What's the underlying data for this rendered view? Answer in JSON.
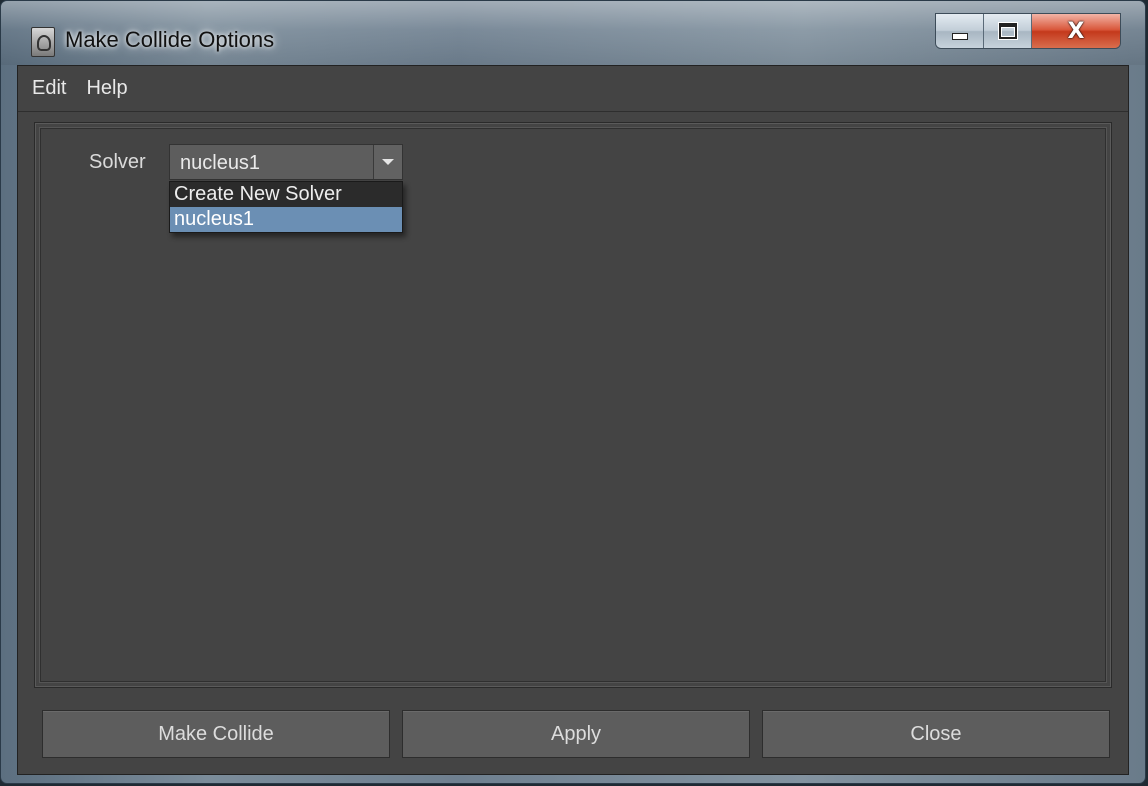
{
  "window": {
    "title": "Make Collide Options",
    "icon": "maya-app-icon"
  },
  "caption_buttons": {
    "minimize_icon": "minimize-icon",
    "maximize_icon": "maximize-icon",
    "close_label": "X"
  },
  "menubar": {
    "items": [
      {
        "label": "Edit"
      },
      {
        "label": "Help"
      }
    ]
  },
  "options": {
    "solver_label": "Solver",
    "solver_value": "nucleus1",
    "dropdown_options": [
      {
        "label": "Create New Solver",
        "selected": false
      },
      {
        "label": "nucleus1",
        "selected": true
      }
    ]
  },
  "actions": {
    "make_collide": "Make Collide",
    "apply": "Apply",
    "close": "Close"
  },
  "colors": {
    "background": "#444444",
    "control": "#5d5d5d",
    "selection": "#6b8fb4",
    "text": "#dcdcdc"
  }
}
